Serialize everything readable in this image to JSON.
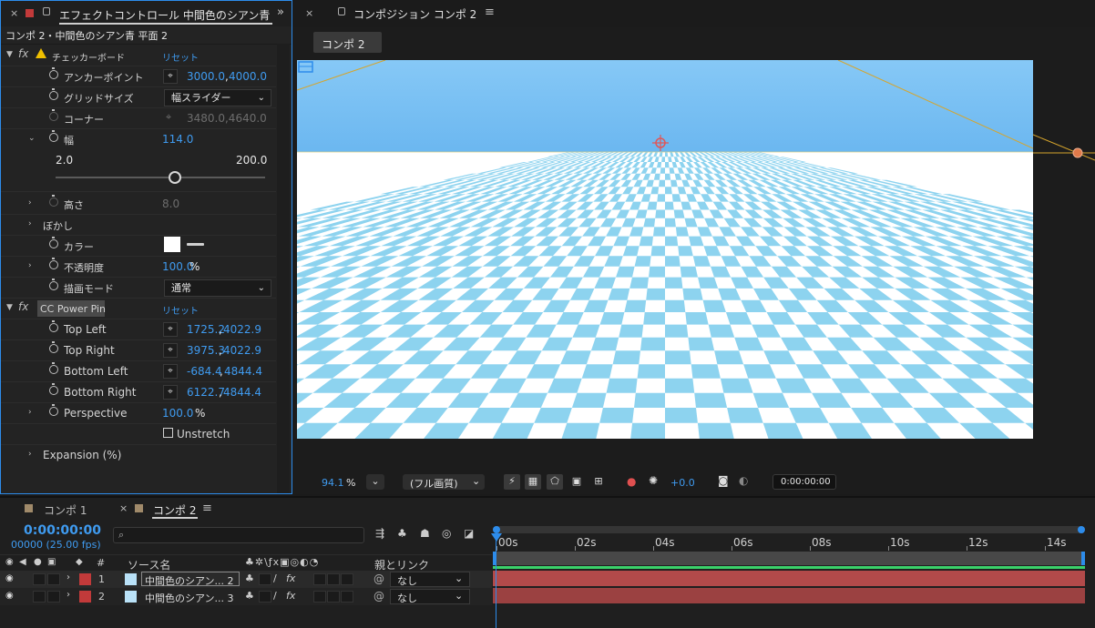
{
  "effect_panel": {
    "tab_title": "エフェクトコントロール 中間色のシアン青",
    "close": "×",
    "overflow": "»",
    "subtitle": "コンポ 2・中間色のシアン青 平面 2",
    "fx": "fx",
    "checker": {
      "name": "チェッカーボード",
      "reset": "リセット",
      "anchor_label": "アンカーポイント",
      "anchor_x": "3000.0",
      "anchor_y": "4000.0",
      "grid_label": "グリッドサイズ",
      "grid_value": "幅スライダー",
      "corner_label": "コーナー",
      "corner_value": "3480.0,4640.0",
      "width_label": "幅",
      "width_value": "114.0",
      "slider_min": "2.0",
      "slider_max": "200.0",
      "slider_fraction": 0.57,
      "height_label": "高さ",
      "height_value": "8.0",
      "feather_label": "ぼかし",
      "color_label": "カラー",
      "opacity_label": "不透明度",
      "opacity_value": "100.0",
      "opacity_unit": "%",
      "blend_label": "描画モード",
      "blend_value": "通常"
    },
    "power_pin": {
      "name": "CC Power Pin",
      "reset": "リセット",
      "top_left_label": "Top Left",
      "top_left_x": "1725.2",
      "top_left_y": "4022.9",
      "top_right_label": "Top Right",
      "top_right_x": "3975.3",
      "top_right_y": "4022.9",
      "bottom_left_label": "Bottom Left",
      "bottom_left_x": "-684.4",
      "bottom_left_y": "4844.4",
      "bottom_right_label": "Bottom Right",
      "bottom_right_x": "6122.7",
      "bottom_right_y": "4844.4",
      "perspective_label": "Perspective",
      "perspective_value": "100.0",
      "perspective_unit": "%",
      "unstretch_label": "Unstretch",
      "expansion_label": "Expansion (%)"
    }
  },
  "comp_panel": {
    "close": "×",
    "title": "コンポジション コンポ 2",
    "menu": "≡",
    "breadcrumb": "コンポ 2",
    "zoom": "94.1",
    "zoom_unit": "%",
    "resolution": "(フル画質)",
    "exposure": "+0.0",
    "timecode": "0:00:00:00",
    "colors": {
      "sky": "#7cc3f5",
      "checker": "#8dd3ef",
      "guide": "#d6a52c"
    }
  },
  "timeline": {
    "tab1": "コンポ 1",
    "tab2_close": "×",
    "tab2": "コンポ 2",
    "menu": "≡",
    "timecode": "0:00:00:00",
    "frames": "00000 (25.00 fps)",
    "search_placeholder": "",
    "col_num": "#",
    "col_source": "ソース名",
    "col_parent": "親とリンク",
    "ruler": [
      "00s",
      "02s",
      "04s",
      "06s",
      "08s",
      "10s",
      "12s",
      "14s"
    ],
    "layers": [
      {
        "num": "1",
        "name": "中間色のシアン... 2",
        "parent": "なし"
      },
      {
        "num": "2",
        "name": "中間色のシアン... 3",
        "parent": "なし"
      }
    ],
    "colors": {
      "label": "#c23a3a",
      "bar": "#b24a4a",
      "timecode": "#3f9bf0",
      "workarea": "#2d8ceb"
    }
  }
}
